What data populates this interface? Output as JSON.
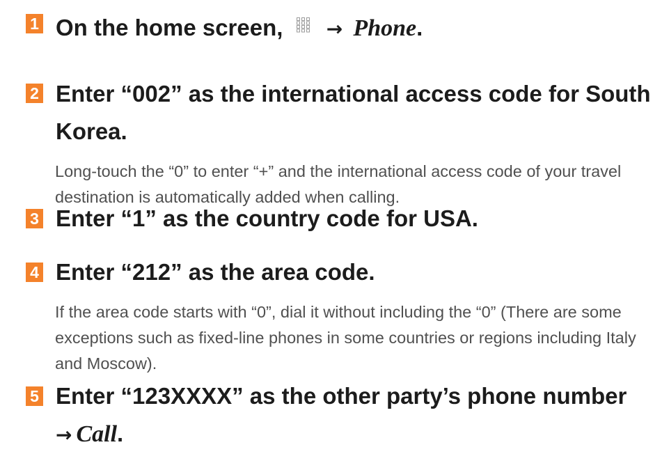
{
  "colors": {
    "badge": "#f4822b",
    "heading": "#1c1c1c",
    "body_text": "#505050"
  },
  "steps": [
    {
      "number": "1",
      "heading_prefix": "On the home screen,",
      "icon": "apps-grid-icon",
      "arrow": "→",
      "heading_target": "Phone",
      "heading_suffix": "."
    },
    {
      "number": "2",
      "heading": "Enter “002” as the international access code for South Korea.",
      "description": "Long-touch the “0” to enter “+” and the international access code of your travel destination is automatically added when calling."
    },
    {
      "number": "3",
      "heading": "Enter “1” as the country code for USA."
    },
    {
      "number": "4",
      "heading": "Enter “212” as the area code.",
      "description": "If the area code starts with “0”, dial it without including the “0” (There are some exceptions such as fixed-line phones in some countries or regions including Italy and Moscow)."
    },
    {
      "number": "5",
      "heading": "Enter “123XXXX” as the other party’s phone number",
      "arrow": "→",
      "heading_target": "Call",
      "heading_suffix": "."
    }
  ]
}
